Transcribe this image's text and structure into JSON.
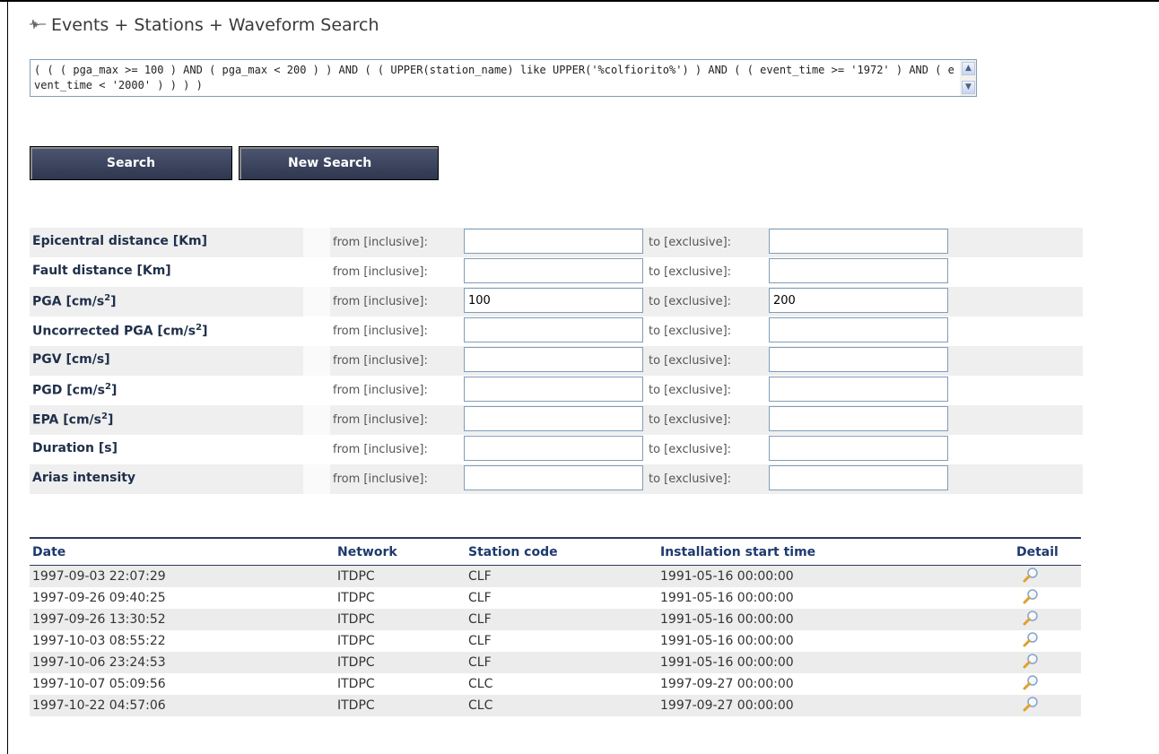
{
  "header": {
    "icon": "waveform-icon",
    "title": "Events + Stations + Waveform Search"
  },
  "query": {
    "text": "( ( ( pga_max >= 100 ) AND ( pga_max < 200 ) ) AND ( ( UPPER(station_name) like UPPER('%colfiorito%') ) AND ( ( event_time >= '1972' ) AND ( event_time < '2000' ) ) ) )"
  },
  "buttons": {
    "search": "Search",
    "new_search": "New Search"
  },
  "filters": {
    "from_label": "from [inclusive]:",
    "to_label": "to [exclusive]:",
    "rows": [
      {
        "label": "Epicentral distance [Km]",
        "from": "",
        "to": ""
      },
      {
        "label": "Fault distance [Km]",
        "from": "",
        "to": ""
      },
      {
        "label": "PGA [cm/s",
        "sup": "2",
        "after": "]",
        "from": "100",
        "to": "200"
      },
      {
        "label": "Uncorrected PGA [cm/s",
        "sup": "2",
        "after": "]",
        "from": "",
        "to": ""
      },
      {
        "label": "PGV [cm/s]",
        "from": "",
        "to": ""
      },
      {
        "label": "PGD [cm/s",
        "sup": "2",
        "after": "]",
        "from": "",
        "to": ""
      },
      {
        "label": "EPA [cm/s",
        "sup": "2",
        "after": "]",
        "from": "",
        "to": ""
      },
      {
        "label": "Duration [s]",
        "from": "",
        "to": ""
      },
      {
        "label": "Arias intensity",
        "from": "",
        "to": ""
      }
    ]
  },
  "results": {
    "headers": {
      "date": "Date",
      "network": "Network",
      "station_code": "Station code",
      "installation": "Installation start time",
      "detail": "Detail"
    },
    "rows": [
      {
        "date": "1997-09-03 22:07:29",
        "network": "ITDPC",
        "station": "CLF",
        "installation": "1991-05-16 00:00:00"
      },
      {
        "date": "1997-09-26 09:40:25",
        "network": "ITDPC",
        "station": "CLF",
        "installation": "1991-05-16 00:00:00"
      },
      {
        "date": "1997-09-26 13:30:52",
        "network": "ITDPC",
        "station": "CLF",
        "installation": "1991-05-16 00:00:00"
      },
      {
        "date": "1997-10-03 08:55:22",
        "network": "ITDPC",
        "station": "CLF",
        "installation": "1991-05-16 00:00:00"
      },
      {
        "date": "1997-10-06 23:24:53",
        "network": "ITDPC",
        "station": "CLF",
        "installation": "1991-05-16 00:00:00"
      },
      {
        "date": "1997-10-07 05:09:56",
        "network": "ITDPC",
        "station": "CLC",
        "installation": "1997-09-27 00:00:00"
      },
      {
        "date": "1997-10-22 04:57:06",
        "network": "ITDPC",
        "station": "CLC",
        "installation": "1997-09-27 00:00:00"
      }
    ]
  }
}
